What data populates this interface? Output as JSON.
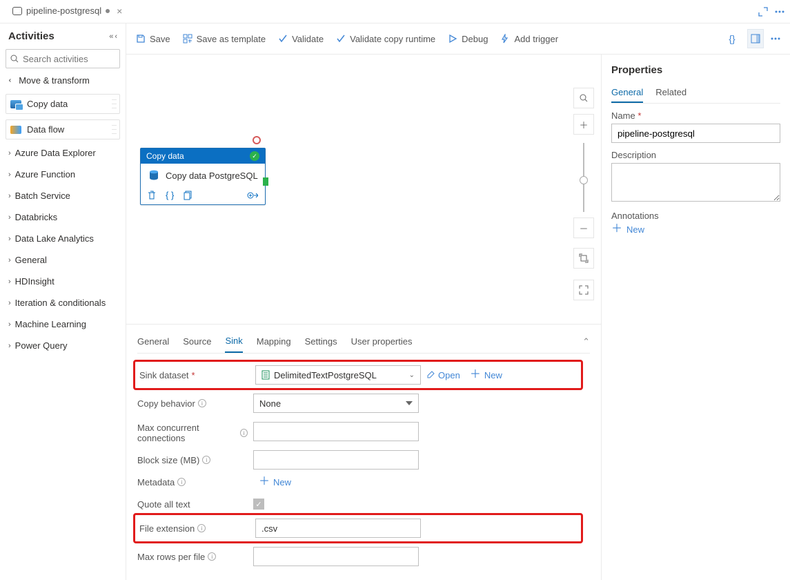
{
  "tab": {
    "title": "pipeline-postgresql"
  },
  "sidebar": {
    "title": "Activities",
    "search_placeholder": "Search activities",
    "move_transform": "Move & transform",
    "move_items": [
      {
        "label": "Copy data"
      },
      {
        "label": "Data flow"
      }
    ],
    "categories": [
      "Azure Data Explorer",
      "Azure Function",
      "Batch Service",
      "Databricks",
      "Data Lake Analytics",
      "General",
      "HDInsight",
      "Iteration & conditionals",
      "Machine Learning",
      "Power Query"
    ]
  },
  "toolbar": {
    "save": "Save",
    "save_template": "Save as template",
    "validate": "Validate",
    "validate_copy": "Validate copy runtime",
    "debug": "Debug",
    "add_trigger": "Add trigger"
  },
  "node": {
    "head": "Copy data",
    "title": "Copy data PostgreSQL"
  },
  "bottom_tabs": [
    "General",
    "Source",
    "Sink",
    "Mapping",
    "Settings",
    "User properties"
  ],
  "sink": {
    "dataset_label": "Sink dataset",
    "dataset_value": "DelimitedTextPostgreSQL",
    "open": "Open",
    "new": "New",
    "copy_behavior_label": "Copy behavior",
    "copy_behavior_value": "None",
    "max_conn_label": "Max concurrent connections",
    "block_size_label": "Block size (MB)",
    "metadata_label": "Metadata",
    "metadata_new": "New",
    "quote_label": "Quote all text",
    "file_ext_label": "File extension",
    "file_ext_value": ".csv",
    "max_rows_label": "Max rows per file"
  },
  "props": {
    "title": "Properties",
    "tabs": {
      "general": "General",
      "related": "Related"
    },
    "name_label": "Name",
    "name_value": "pipeline-postgresql",
    "desc_label": "Description",
    "anno_label": "Annotations",
    "new": "New"
  }
}
